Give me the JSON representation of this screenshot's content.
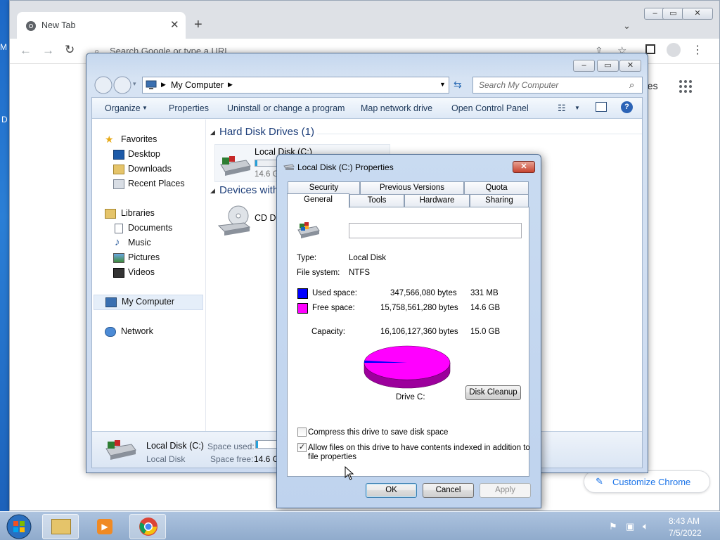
{
  "desktop": {
    "edge_left_top": "M",
    "edge_left_mid": "D"
  },
  "chrome": {
    "tab_title": "New Tab",
    "omnibox_placeholder": "Search Google or type a URL",
    "right_link_fragment": "ges",
    "customize_label": "Customize Chrome"
  },
  "explorer": {
    "breadcrumb": "My Computer",
    "search_placeholder": "Search My Computer",
    "commands": [
      "Organize",
      "Properties",
      "Uninstall or change a program",
      "Map network drive",
      "Open Control Panel"
    ],
    "nav": {
      "favorites": "Favorites",
      "desktop": "Desktop",
      "downloads": "Downloads",
      "recent": "Recent Places",
      "libraries": "Libraries",
      "documents": "Documents",
      "music": "Music",
      "pictures": "Pictures",
      "videos": "Videos",
      "computer": "My Computer",
      "network": "Network"
    },
    "groups": {
      "hdd": "Hard Disk Drives (1)",
      "removable": "Devices with"
    },
    "drive_name": "Local Disk (C:)",
    "drive_free_fragment": "14.6 G",
    "cd_fragment": "CD Dr",
    "status": {
      "name": "Local Disk (C:)",
      "type": "Local Disk",
      "space_used_label": "Space used:",
      "space_free_label": "Space free:",
      "space_free_value": "14.6 G"
    }
  },
  "dialog": {
    "title": "Local Disk (C:) Properties",
    "tabs_top": [
      "Security",
      "Previous Versions",
      "Quota"
    ],
    "tabs_bottom": [
      "General",
      "Tools",
      "Hardware",
      "Sharing"
    ],
    "label_value": "",
    "type_label": "Type:",
    "type_value": "Local Disk",
    "fs_label": "File system:",
    "fs_value": "NTFS",
    "used_label": "Used space:",
    "used_bytes": "347,566,080 bytes",
    "used_h": "331 MB",
    "free_label": "Free space:",
    "free_bytes": "15,758,561,280 bytes",
    "free_h": "14.6 GB",
    "cap_label": "Capacity:",
    "cap_bytes": "16,106,127,360 bytes",
    "cap_h": "15.0 GB",
    "drive_caption": "Drive C:",
    "cleanup": "Disk Cleanup",
    "compress": "Compress this drive to save disk space",
    "index_line1": "Allow files on this drive to have contents indexed in addition to",
    "index_line2": "file properties",
    "compress_checked": false,
    "index_checked": true,
    "ok": "OK",
    "cancel": "Cancel",
    "apply": "Apply",
    "used_fraction": 0.0216,
    "colors": {
      "used": "#0000ff",
      "free": "#ff00ff"
    }
  },
  "taskbar": {
    "time": "8:43 AM",
    "date": "7/5/2022"
  }
}
